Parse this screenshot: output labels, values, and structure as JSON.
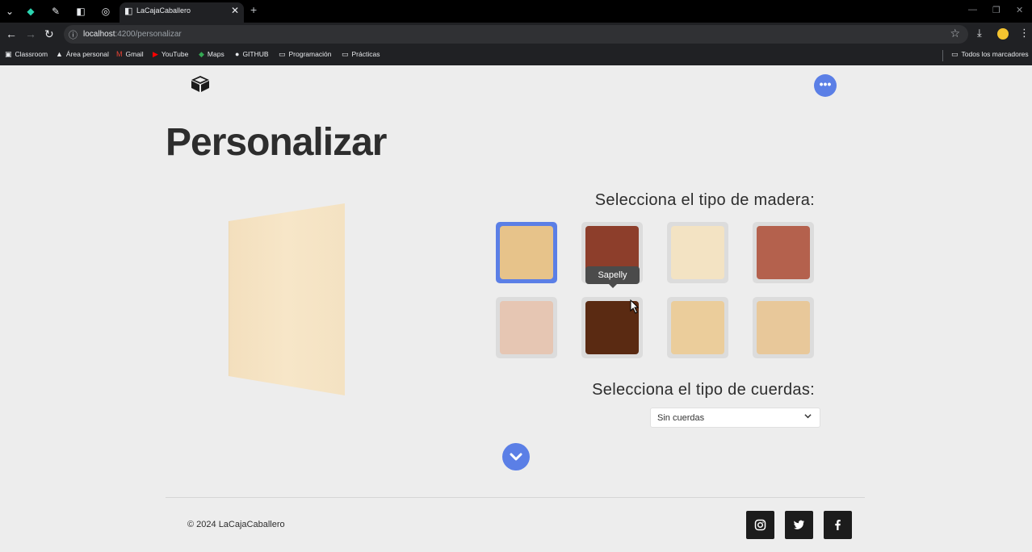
{
  "browser": {
    "tab_title": "LaCajaCaballero",
    "url_host": "localhost",
    "url_path": ":4200/personalizar",
    "bookmarks": [
      "Classroom",
      "Área personal",
      "Gmail",
      "YouTube",
      "Maps",
      "GITHUB",
      "Programación",
      "Prácticas"
    ],
    "all_bookmarks": "Todos los marcadores"
  },
  "page": {
    "title": "Personalizar",
    "wood_heading": "Selecciona el tipo de madera:",
    "wood_swatches": [
      {
        "color": "#e7c38a",
        "selected": true
      },
      {
        "color": "#8d3e2b",
        "selected": false
      },
      {
        "color": "#f3e3c3",
        "selected": false
      },
      {
        "color": "#b4614d",
        "selected": false
      },
      {
        "color": "#e6c6b3",
        "selected": false
      },
      {
        "color": "#5a2a12",
        "selected": false
      },
      {
        "color": "#ebcd9b",
        "selected": false
      },
      {
        "color": "#e8c89a",
        "selected": false
      }
    ],
    "tooltip": "Sapelly",
    "strings_heading": "Selecciona el tipo de cuerdas:",
    "strings_select_value": "Sin cuerdas",
    "copyright": "© 2024 LaCajaCaballero",
    "accent_color": "#5b7fe6"
  }
}
